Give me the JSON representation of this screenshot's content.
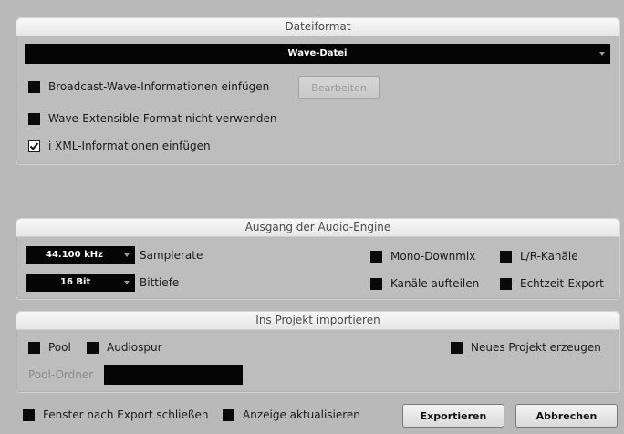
{
  "dateiformat": {
    "header": "Dateiformat",
    "format_value": "Wave-Datei",
    "broadcast_label": "Broadcast-Wave-Informationen einfügen",
    "broadcast_checked": false,
    "edit_button": "Bearbeiten",
    "wave_extensible_label": "Wave-Extensible-Format nicht verwenden",
    "wave_extensible_checked": false,
    "ixml_label": "i XML-Informationen einfügen",
    "ixml_checked": true
  },
  "audio_engine": {
    "header": "Ausgang der Audio-Engine",
    "samplerate_value": "44.100 kHz",
    "samplerate_label": "Samplerate",
    "bittiefe_value": "16 Bit",
    "bittiefe_label": "Bittiefe",
    "mono_downmix_label": "Mono-Downmix",
    "lr_kanaele_label": "L/R-Kanäle",
    "kanaele_aufteilen_label": "Kanäle aufteilen",
    "echtzeit_export_label": "Echtzeit-Export"
  },
  "import": {
    "header": "Ins Projekt importieren",
    "pool_label": "Pool",
    "audiospur_label": "Audiospur",
    "neues_projekt_label": "Neues Projekt erzeugen",
    "pool_ordner_label": "Pool-Ordner",
    "pool_ordner_value": ""
  },
  "footer": {
    "close_after_export_label": "Fenster nach Export schließen",
    "update_display_label": "Anzeige aktualisieren",
    "export_button": "Exportieren",
    "cancel_button": "Abbrechen"
  }
}
